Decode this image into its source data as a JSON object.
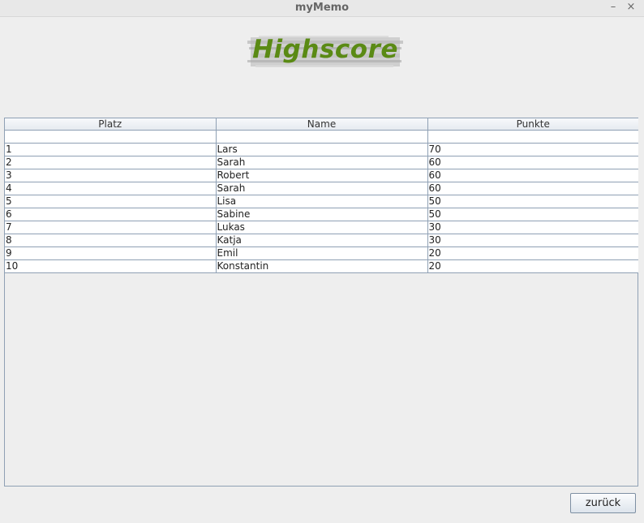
{
  "window": {
    "title": "myMemo",
    "minimize_glyph": "–",
    "close_glyph": "×"
  },
  "logo": {
    "text": "Highscore",
    "color": "#5a8a14"
  },
  "table": {
    "columns": [
      "Platz",
      "Name",
      "Punkte"
    ],
    "rows": [
      [
        "",
        "",
        ""
      ],
      [
        "1",
        "Lars",
        "70"
      ],
      [
        "2",
        "Sarah",
        "60"
      ],
      [
        "3",
        "Robert",
        "60"
      ],
      [
        "4",
        "Sarah",
        "60"
      ],
      [
        "5",
        "Lisa",
        "50"
      ],
      [
        "6",
        "Sabine",
        "50"
      ],
      [
        "7",
        "Lukas",
        "30"
      ],
      [
        "8",
        "Katja",
        "30"
      ],
      [
        "9",
        "Emil",
        "20"
      ],
      [
        "10",
        "Konstantin",
        "20"
      ]
    ]
  },
  "buttons": {
    "back_label": "zurück"
  }
}
